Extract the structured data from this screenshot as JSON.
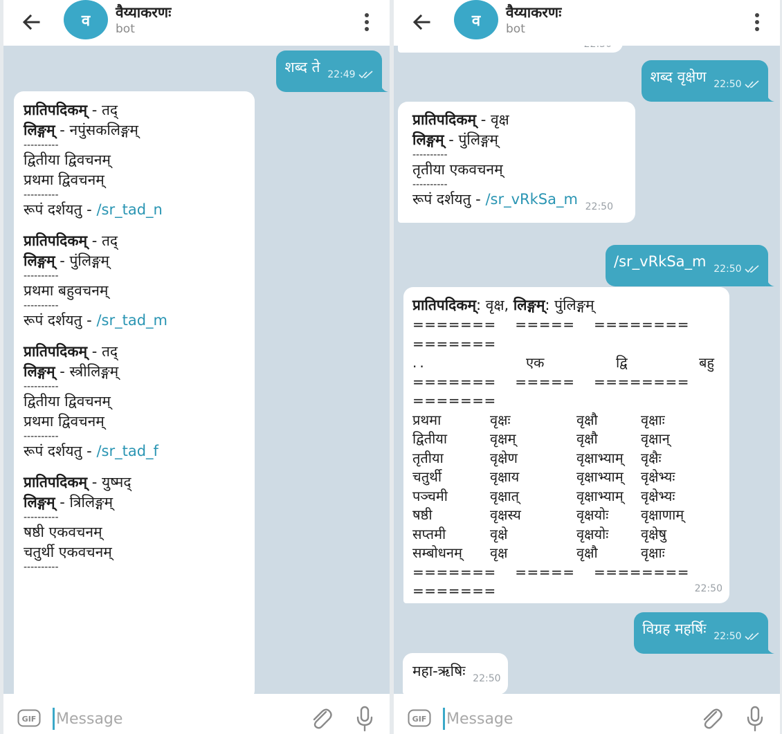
{
  "colors": {
    "accent": "#3fa7c2",
    "link": "#2a95b3",
    "chat_bg": "#cfdbe4"
  },
  "left_pane": {
    "header": {
      "avatar_letter": "व",
      "title": "वैय्याकरणः",
      "subtitle": "bot"
    },
    "outgoing": {
      "text": "शब्द ते",
      "time": "22:49"
    },
    "reply_blocks": [
      {
        "stem_label": "प्रातिपदिकम्",
        "stem_value": " - तद्",
        "gender_label": "लिङ्गम्",
        "gender_value": " - नपुंसकलिङ्गम्",
        "dash1": "----------",
        "forms": [
          "द्वितीया द्विवचनम्",
          "प्रथमा द्विवचनम्"
        ],
        "dash2": "----------",
        "show_label": "रूपं दर्शयतु - ",
        "link": "/sr_tad_n"
      },
      {
        "stem_label": "प्रातिपदिकम्",
        "stem_value": " - तद्",
        "gender_label": "लिङ्गम्",
        "gender_value": " - पुंलिङ्गम्",
        "dash1": "----------",
        "forms": [
          "प्रथमा बहुवचनम्"
        ],
        "dash2": "----------",
        "show_label": "रूपं दर्शयतु - ",
        "link": "/sr_tad_m"
      },
      {
        "stem_label": "प्रातिपदिकम्",
        "stem_value": " - तद्",
        "gender_label": "लिङ्गम्",
        "gender_value": " - स्त्रीलिङ्गम्",
        "dash1": "----------",
        "forms": [
          "द्वितीया द्विवचनम्",
          "प्रथमा द्विवचनम्"
        ],
        "dash2": "----------",
        "show_label": "रूपं दर्शयतु - ",
        "link": "/sr_tad_f"
      },
      {
        "stem_label": "प्रातिपदिकम्",
        "stem_value": " - युष्मद्",
        "gender_label": "लिङ्गम्",
        "gender_value": " - त्रिलिङ्गम्",
        "dash1": "----------",
        "forms": [
          "षष्ठी एकवचनम्",
          "चतुर्थी एकवचनम्"
        ],
        "dash2": "----------"
      }
    ],
    "input": {
      "placeholder": "Message",
      "gif_label": "GIF"
    }
  },
  "right_pane": {
    "header": {
      "avatar_letter": "व",
      "title": "वैय्याकरणः",
      "subtitle": "bot"
    },
    "partial_time": "22:50",
    "msg1": {
      "text": "शब्द वृक्षेण",
      "time": "22:50"
    },
    "reply1": {
      "stem_label": "प्रातिपदिकम्",
      "stem_value": " - वृक्ष",
      "gender_label": "लिङ्गम्",
      "gender_value": " - पुंलिङ्गम्",
      "dash1": "----------",
      "form": "तृतीया एकवचनम्",
      "dash2": "----------",
      "show_label": "रूपं दर्शयतु - ",
      "link": "/sr_vRkSa_m",
      "time": "22:50"
    },
    "msg2": {
      "text": "/sr_vRkSa_m",
      "time": "22:50"
    },
    "table": {
      "stem_label": "प्रातिपदिकम्",
      "stem_value": ": वृक्ष, ",
      "gender_label": "लिङ्गम्",
      "gender_value": ": पुंलिङ्गम्",
      "sep1": "=======    =====    ========",
      "sep2": "=======",
      "header": [
        "..",
        "एक",
        "द्वि",
        "बहु"
      ],
      "rows": [
        [
          "प्रथमा",
          "वृक्षः",
          "वृक्षौ",
          "वृक्षाः"
        ],
        [
          "द्वितीया",
          "वृक्षम्",
          "वृक्षौ",
          "वृक्षान्"
        ],
        [
          "तृतीया",
          "वृक्षेण",
          "वृक्षाभ्याम्",
          "वृक्षैः"
        ],
        [
          "चतुर्थी",
          "वृक्षाय",
          "वृक्षाभ्याम्",
          "वृक्षेभ्यः"
        ],
        [
          "पञ्चमी",
          "वृक्षात्",
          "वृक्षाभ्याम्",
          "वृक्षेभ्यः"
        ],
        [
          "षष्ठी",
          "वृक्षस्य",
          "वृक्षयोः",
          "वृक्षाणाम्"
        ],
        [
          "सप्तमी",
          "वृक्षे",
          "वृक्षयोः",
          "वृक्षेषु"
        ],
        [
          "सम्बोधनम्",
          "वृक्ष",
          "वृक्षौ",
          "वृक्षाः"
        ]
      ],
      "time": "22:50"
    },
    "msg3": {
      "text": "विग्रह महर्षिः",
      "time": "22:50"
    },
    "reply3": {
      "text": "महा-ऋषिः",
      "time": "22:50"
    },
    "input": {
      "placeholder": "Message",
      "gif_label": "GIF"
    }
  }
}
